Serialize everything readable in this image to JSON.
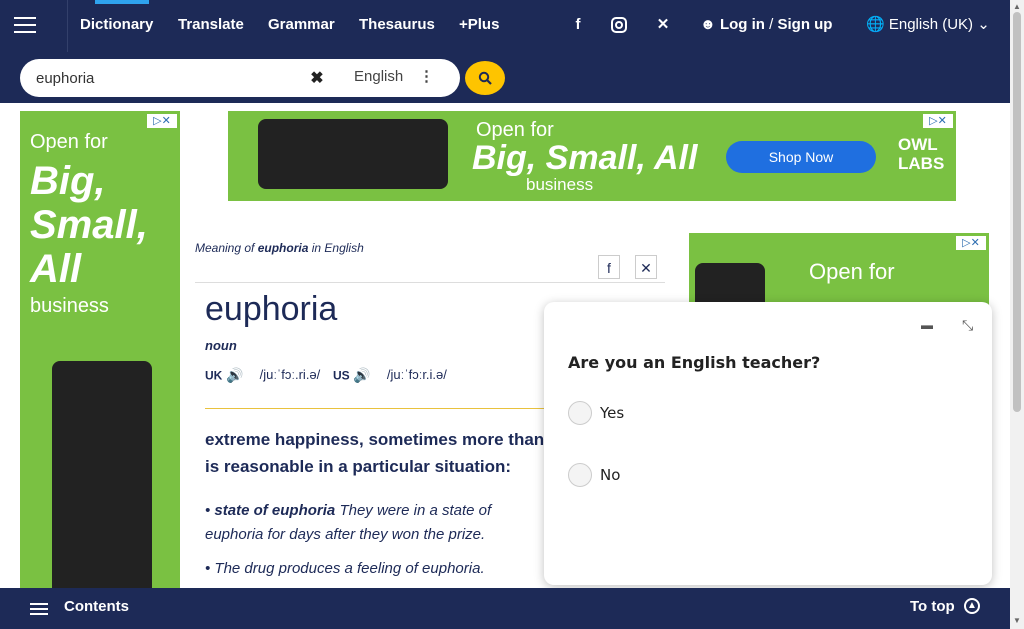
{
  "nav": {
    "items": [
      {
        "label": "Dictionary"
      },
      {
        "label": "Translate"
      },
      {
        "label": "Grammar"
      },
      {
        "label": "Thesaurus"
      },
      {
        "label": "+Plus"
      }
    ],
    "login": "Log in",
    "separator": "/",
    "signup": "Sign up",
    "language": "English (UK)"
  },
  "search": {
    "value": "euphoria",
    "dictionary": "English"
  },
  "ads": {
    "line1": "Open for",
    "line2": "Big, Small, All",
    "line3": "business",
    "cta": "Shop Now",
    "brand": "OWL LABS"
  },
  "entry": {
    "meaning_prefix": "Meaning of",
    "headword": "euphoria",
    "meaning_suffix": "in English",
    "pos": "noun",
    "uk_label": "UK",
    "uk_ipa": "/juːˈfɔː.ri.ə/",
    "us_label": "US",
    "us_ipa": "/juːˈfɔːr.i.ə/",
    "definition": "extreme happiness, sometimes more than is reasonable in a particular situation:",
    "example1_bold": "state of euphoria",
    "example1_rest": "They were in a state of euphoria for days after they won the prize.",
    "example2": "The drug produces a feeling of euphoria."
  },
  "popup": {
    "question": "Are you an English teacher?",
    "options": [
      "Yes",
      "No"
    ]
  },
  "bottom": {
    "contents": "Contents",
    "to_top": "To top"
  }
}
